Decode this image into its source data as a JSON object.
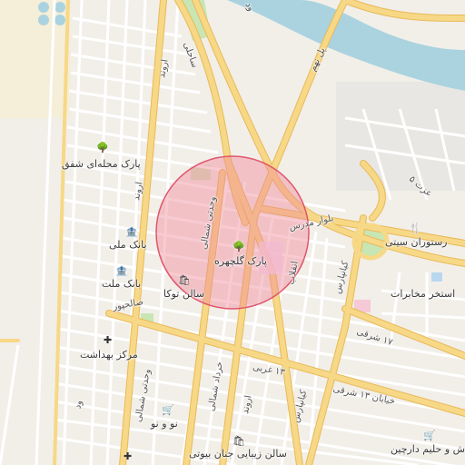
{
  "map": {
    "colors": {
      "background": "#f2efe9",
      "major_road": "#f7d886",
      "major_road_edge": "#e8b95a",
      "minor_road": "#ffffff",
      "river": "#aad3df",
      "park": "#c8e6b3",
      "highlight_fill": "#f08a9a",
      "highlight_stroke": "#e0566d"
    },
    "highlight_circle": {
      "label": "پارک گلچهره",
      "icon": "tree-icon"
    },
    "pois": [
      {
        "id": "park-mahalle-shafagh",
        "label": "پارک محله‌ای شفق",
        "icon": "tree-icon"
      },
      {
        "id": "park-golchehre",
        "label": "پارک گلچهره",
        "icon": "tree-icon"
      },
      {
        "id": "bank-melli",
        "label": "بانک ملی",
        "icon": "bank-icon"
      },
      {
        "id": "bank-mellat",
        "label": "بانک ملت",
        "icon": "bank-icon"
      },
      {
        "id": "salon-toka",
        "label": "سالن توکا",
        "icon": "bag-icon"
      },
      {
        "id": "markaz-behdasht",
        "label": "مرکز بهداشت",
        "icon": "cross-icon"
      },
      {
        "id": "no-o-no",
        "label": "نو و نو",
        "icon": "shop-icon"
      },
      {
        "id": "salon-jenan",
        "label": "سالن زیبایی جنان بیوتی",
        "icon": "bag-icon"
      },
      {
        "id": "restaurant-siti",
        "label": "رستوران سیتی",
        "icon": "restaurant-icon"
      },
      {
        "id": "estakhr-mokhaberat",
        "label": "استخر مخابرات",
        "icon": ""
      },
      {
        "id": "halim",
        "label": "ش و حلیم دارچین",
        "icon": "shop-icon"
      }
    ],
    "streets": [
      {
        "id": "arvand-top",
        "label": "اروند"
      },
      {
        "id": "arvand-mid",
        "label": "اروند"
      },
      {
        "id": "arvand-bottom",
        "label": "اروند"
      },
      {
        "id": "sahelie",
        "label": "ساحلی"
      },
      {
        "id": "pol-nahom",
        "label": "پل نهم"
      },
      {
        "id": "ezzat5",
        "label": "عزت ۵"
      },
      {
        "id": "bolvar-modares",
        "label": "بلوار مدرس"
      },
      {
        "id": "vahdati-shomali-1",
        "label": "وحدتی شمالی"
      },
      {
        "id": "vahdati-shomali-2",
        "label": "وحدتی شمالی"
      },
      {
        "id": "enqelab",
        "label": "انقلاب"
      },
      {
        "id": "kianpars-1",
        "label": "کیانپارس"
      },
      {
        "id": "kianpars-2",
        "label": "کیانپارس"
      },
      {
        "id": "salehpour",
        "label": "صالحپور"
      },
      {
        "id": "sharghi17",
        "label": "۱۷ شرقی"
      },
      {
        "id": "gharbi13",
        "label": "۱۳ غربی"
      },
      {
        "id": "sharghi13",
        "label": "خیابان ۱۳ شرقی"
      },
      {
        "id": "khordad-shomali",
        "label": "خرداد شمالی"
      },
      {
        "id": "arvand2",
        "label": "اروند"
      },
      {
        "id": "shahid-v",
        "label": "ود"
      }
    ]
  }
}
